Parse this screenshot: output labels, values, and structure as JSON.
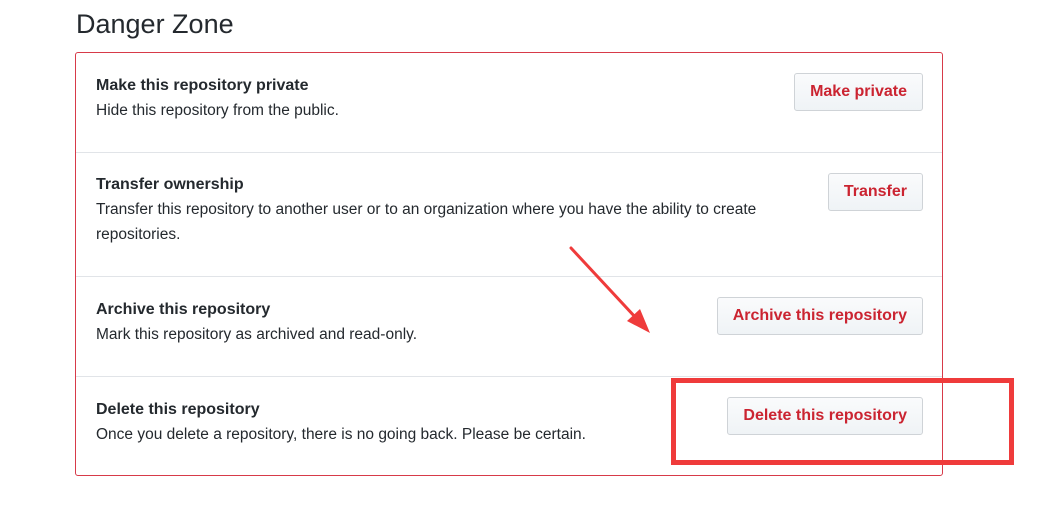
{
  "section": {
    "title": "Danger Zone"
  },
  "rows": [
    {
      "title": "Make this repository private",
      "description": "Hide this repository from the public.",
      "button_label": "Make private"
    },
    {
      "title": "Transfer ownership",
      "description": "Transfer this repository to another user or to an organization where you have the ability to create repositories.",
      "button_label": "Transfer"
    },
    {
      "title": "Archive this repository",
      "description": "Mark this repository as archived and read-only.",
      "button_label": "Archive this repository"
    },
    {
      "title": "Delete this repository",
      "description": "Once you delete a repository, there is no going back. Please be certain.",
      "button_label": "Delete this repository"
    }
  ],
  "colors": {
    "danger_border": "#d73a49",
    "danger_text": "#cb2431",
    "annotation_red": "#ef3b3b"
  }
}
